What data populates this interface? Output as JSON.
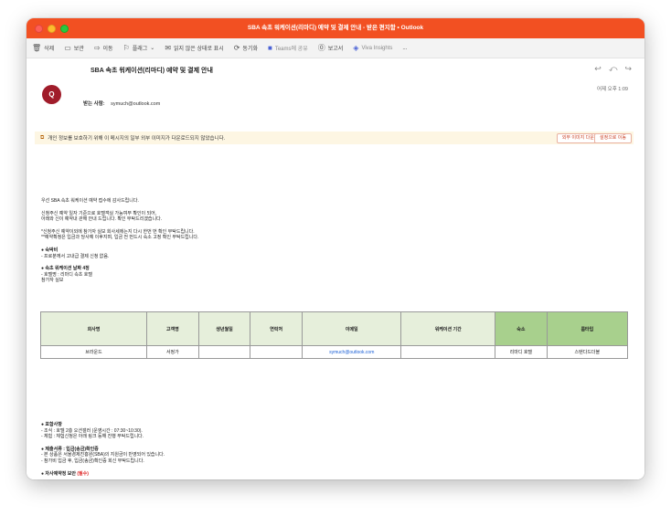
{
  "window": {
    "title": "SBA 속초 워케이션(리마디) 예약 및 결제 안내 - 받은 편지함 • Outlook"
  },
  "toolbar": {
    "items": [
      {
        "label": "삭제",
        "icon": "trash-icon"
      },
      {
        "label": "보관",
        "icon": "archive-icon"
      },
      {
        "label": "이동",
        "icon": "move-icon"
      },
      {
        "label": "플래그",
        "icon": "flag-icon"
      },
      {
        "label": "읽지 않은 상태로 표시",
        "icon": "envelope-icon"
      },
      {
        "label": "동기화",
        "icon": "sync-icon"
      },
      {
        "label": "Teams에 공유",
        "icon": "teams-icon"
      },
      {
        "label": "보고서",
        "icon": "report-icon"
      },
      {
        "label": "Viva Insights",
        "icon": "viva-insights-icon"
      },
      {
        "label": "...",
        "icon": "more-icon"
      }
    ]
  },
  "message": {
    "subject": "SBA 속초 워케이션(리마디) 예약 및 결제 안내",
    "avatar_initial": "Q",
    "datetime": "어제 오후 1:09",
    "recipient_label": "받는 사람:",
    "recipient": "symuch@outlook.com"
  },
  "infobar": {
    "message": "개인 정보를 보호하기 위해 이 메시지의 일부 외부 이미지가 다운로드되지 않았습니다.",
    "download_label": "외부 이미지 다운로드",
    "settings_label": "설정으로 이동"
  },
  "body": {
    "line1": "우선 SBA 속초 워케이션 예약 접수에 감사드립니다.",
    "line2": "신청주신 예약 일자 기준으로 호텔객실 가능여부 확인이 되어,",
    "line3": "아래와 신이 예약내 관해 안내 드립니다. 확인 부탁드리겠습니다.",
    "line4": "*신청주신 예약이외에 참가자 실보 회사세에는지 다시 한번 번 확인 부탁드립니다.",
    "line5": "**예약확정은 입금과 당사예 이후지며, 입금 전 먼드시 숙소 고정 확인 부탁드립니다.",
    "h1": "● 숙박비",
    "h1_line": "- 프로분께서 고내급 결제 신청 없음.",
    "h2": "● 속초 워케이션 날짜 4정",
    "h2_line1": "- 호텔명 : 리마디 속초 호텔",
    "h2_line2": "  참가자 실보"
  },
  "table": {
    "headers": [
      "회사명",
      "고객명",
      "생년월일",
      "연락처",
      "이메일",
      "워케이션 기간",
      "숙소",
      "룸타입"
    ],
    "row": [
      "브라운드",
      "서정가",
      "",
      "",
      "symuch@outlook.com",
      "",
      "리마디 호텔",
      "스탠다드더블"
    ]
  },
  "body2": {
    "h3": "● 포함사항",
    "h3_line1": "- 조식 : 호텔 2층 오션갤러 (운영시간 : 07:30~10:30).",
    "h3_line2": "- 체험 : 체험신청은 아래 링크 등해 진행 부탁드립니다.",
    "h4": "● 제출서류 : 입금(송금)확인증",
    "h4_line1": "- 본 상품은 서울경제진흥원(SBA)의 지원금이 반영되어 있습니다.",
    "h4_line2": "- 참가비 입금 후, 입금(송금)확인증 회신 부탁드립니다.",
    "h5": "● 자사예약정 보안",
    "h5_tag": "(필수)"
  },
  "colors": {
    "titlebar": "#f25022",
    "avatar": "#a01c2a",
    "table_header": "#e6efdb",
    "table_header_accent": "#a8d08d"
  }
}
